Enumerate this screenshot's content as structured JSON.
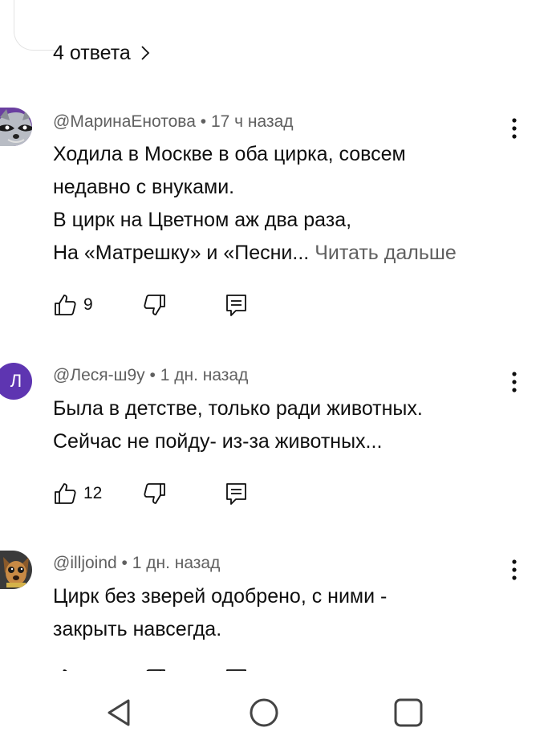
{
  "replies_link": {
    "label": "4 ответа"
  },
  "comments": [
    {
      "author": "@МаринаЕнотова",
      "time": "17 ч назад",
      "text": "Ходила в Москве в оба цирка, совсем\nнедавно с внуками.\nВ цирк на Цветном аж два раза,\nНа «Матрешку» и «Песни...",
      "read_more": "Читать дальше",
      "likes": "9",
      "avatar_icon": "raccoon-avatar"
    },
    {
      "author": "@Леся-ш9у",
      "time": "1 дн. назад",
      "text": "Была в детстве, только ради животных.\nСейчас не пойду- из-за животных...",
      "likes": "12",
      "avatar_letter": "Л",
      "avatar_color": "#5e35b1"
    },
    {
      "author": "@illjoind",
      "time": "1 дн. назад",
      "text": "Цирк без зверей одобрено, с ними -\nзакрыть навсегда.",
      "avatar_icon": "dog-avatar"
    }
  ],
  "meta_separator": "•",
  "icons": [
    "chevron-right-icon",
    "more-vert-icon",
    "thumb-up-icon",
    "thumb-down-icon",
    "reply-icon",
    "back-icon",
    "home-icon",
    "recents-icon"
  ],
  "colors": {
    "text": "#0f0f0f",
    "secondary": "#606060",
    "divider": "#e3e3e3"
  }
}
